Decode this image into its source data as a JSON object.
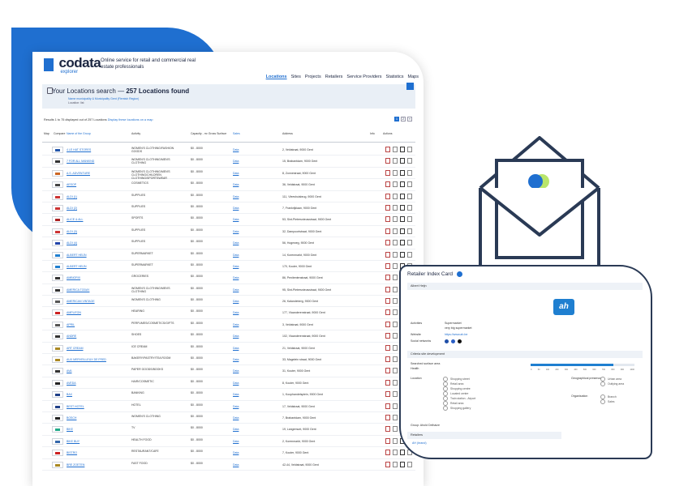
{
  "header": {
    "logo_main": "codata",
    "logo_sub": "explorer",
    "tagline": "Online service for retail and commercial real estate professionals"
  },
  "nav": [
    "Locations",
    "Sites",
    "Projects",
    "Retailers",
    "Service Providers",
    "Statistics",
    "Maps"
  ],
  "search": {
    "title_prefix": "Your Locations search",
    "title_count": "257 Locations found",
    "crumb_line1": "Name municipality & Municipality Gent (Flemish Region)",
    "crumb_line2": "Location: list"
  },
  "results": {
    "info": "Results 1 to 75 displayed out of 257 Locations",
    "map_link": "Display these locations on a map",
    "pages": [
      "1",
      "2",
      "»"
    ]
  },
  "table": {
    "headers": [
      "Map",
      "Compare",
      "Name of the Group",
      "Activity",
      "Capacity - m² Gross Surface",
      "Sales",
      "Address",
      "Info",
      "Actions"
    ],
    "rows": [
      {
        "name": "4 LE HAT STORES",
        "cat": "WOMEN'S CLOTHING/FASHION GOODS",
        "cap": "$0 - 8000",
        "sales": "Data",
        "addr": "2, Veldstraat, 9000 Gent",
        "color": "#2255aa"
      },
      {
        "name": "7 FOR ALL MANKIND",
        "cat": "WOMEN'S CLOTHING/MEN'S CLOTHING",
        "cap": "$0 - 8000",
        "sales": "Data",
        "addr": "15, Brabantdam, 9000 Gent",
        "color": "#333333"
      },
      {
        "name": "A.S. ADVENTURE",
        "cat": "WOMEN'S CLOTHING/MEN'S CLOTHING/CHILDREN CLOTHING/SPORTSWEAR",
        "cap": "$0 - 8000",
        "sales": "Data",
        "addr": "8, Zonnestraat, 9000 Gent",
        "color": "#cc6622"
      },
      {
        "name": "AESOP",
        "cat": "COSMETICS",
        "cap": "$0 - 8000",
        "sales": "Data",
        "addr": "36, Veldstraat, 9000 Gent",
        "color": "#444444"
      },
      {
        "name": "ALDI (1)",
        "cat": "SUPPLIES",
        "cap": "$0 - 8000",
        "sales": "Data",
        "addr": "111, Vleeshuisbrug, 9000 Gent",
        "color": "#cc3333"
      },
      {
        "name": "ALDI (2)",
        "cat": "SUPPLIES",
        "cap": "$0 - 8000",
        "sales": "Data",
        "addr": "7, Frankrijklaan, 9000 Gent",
        "color": "#cc3333"
      },
      {
        "name": "ALICE & ALL",
        "cat": "SPORTS",
        "cap": "$0 - 8000",
        "sales": "Data",
        "addr": "53, Sint-Pietersnieuwstraat, 9000 Gent",
        "color": "#aa2222"
      },
      {
        "name": "ALDI (3)",
        "cat": "SUPPLIES",
        "cap": "$0 - 8000",
        "sales": "Data",
        "addr": "32, Dampoortstraat, 9000 Gent",
        "color": "#cc3333"
      },
      {
        "name": "ALDI (4)",
        "cat": "SUPPLIES",
        "cap": "$0 - 8000",
        "sales": "Data",
        "addr": "56, Hogeweg, 9000 Gent",
        "color": "#2244aa"
      },
      {
        "name": "ALBERT HEIJN",
        "cat": "SUPERMARKET",
        "cap": "$0 - 8000",
        "sales": "Data",
        "addr": "14, Korenmarkt, 9000 Gent",
        "color": "#1f7fd0"
      },
      {
        "name": "ALBERT HEIJN",
        "cat": "SUPERMARKET",
        "cap": "$0 - 8000",
        "sales": "Data",
        "addr": "170, Kouter, 9000 Gent",
        "color": "#1f7fd0"
      },
      {
        "name": "AMBIORIX",
        "cat": "GROCERIES",
        "cap": "$0 - 8000",
        "sales": "Data",
        "addr": "86, Penitentenstraat, 9000 Gent",
        "color": "#333333"
      },
      {
        "name": "AMERICA TODAY",
        "cat": "WOMEN'S CLOTHING/MEN'S CLOTHING",
        "cap": "$0 - 8000",
        "sales": "Data",
        "addr": "95, Sint-Pietersnieuwstraat, 9000 Gent",
        "color": "#333333"
      },
      {
        "name": "AMERICAN VINTAGE",
        "cat": "WOMEN'S CLOTHING",
        "cap": "$0 - 8000",
        "sales": "Data",
        "addr": "26, Kalandeberg, 9000 Gent",
        "color": "#555555"
      },
      {
        "name": "AMPLIFON",
        "cat": "HEARING",
        "cap": "$0 - 8000",
        "sales": "Data",
        "addr": "177, Vlaanderenstraat, 9000 Gent",
        "color": "#cc2222"
      },
      {
        "name": "APRIL",
        "cat": "PERFUMES/COSMETICS/GIFTS",
        "cap": "$0 - 8000",
        "sales": "Data",
        "addr": "3, Veldstraat, 9000 Gent",
        "color": "#555555"
      },
      {
        "name": "ANDRE",
        "cat": "SHOES",
        "cap": "$0 - 8000",
        "sales": "Data",
        "addr": "102, Vlaanderenstraat, 9000 Gent",
        "color": "#333333"
      },
      {
        "name": "ART CREAM",
        "cat": "ICE CREAM",
        "cap": "$0 - 8000",
        "sales": "Data",
        "addr": "21, Veldstraat, 9000 Gent",
        "color": "#aa8822"
      },
      {
        "name": "AUX MERVEILLEUX DE FRED",
        "cat": "BAKERY/PASTRY/TEA ROOM",
        "cap": "$0 - 8000",
        "sales": "Data",
        "addr": "33, Magelein straat, 9000 Gent",
        "color": "#aa8822"
      },
      {
        "name": "AVA",
        "cat": "PAPER GOODS/BOOKS",
        "cap": "$0 - 8000",
        "sales": "Data",
        "addr": "31, Kouter, 9000 Gent",
        "color": "#333333"
      },
      {
        "name": "AVEDA",
        "cat": "HAIR/COSMETIC",
        "cap": "$0 - 8000",
        "sales": "Data",
        "addr": "8, Kouter, 9000 Gent",
        "color": "#222222"
      },
      {
        "name": "BAX",
        "cat": "BANKING",
        "cap": "$0 - 8000",
        "sales": "Data",
        "addr": "1, Koophandelsplein, 9000 Gent",
        "color": "#1f3f88"
      },
      {
        "name": "BEST HOTEL",
        "cat": "HOTEL",
        "cap": "$0 - 8000",
        "sales": "Data",
        "addr": "17, Veldstraat, 9000 Gent",
        "color": "#1f3f88"
      },
      {
        "name": "BOSCH",
        "cat": "WOMEN'S CLOTHING",
        "cap": "$0 - 8000",
        "sales": "Data",
        "addr": "7, Brabantdam, 9000 Gent",
        "color": "#222222"
      },
      {
        "name": "BIKE",
        "cat": "TV",
        "cap": "$0 - 8000",
        "sales": "Data",
        "addr": "19, Langemunt, 9000 Gent",
        "color": "#22aa88"
      },
      {
        "name": "BIKE BUY",
        "cat": "HEALTH FOOD",
        "cap": "$0 - 8000",
        "sales": "Data",
        "addr": "2, Korenmarkt, 9000 Gent",
        "color": "#3366aa"
      },
      {
        "name": "BISTRO",
        "cat": "RESTAURANT/CAFE",
        "cap": "$0 - 8000",
        "sales": "Data",
        "addr": "7, Kouter, 9000 Gent",
        "color": "#cc2222"
      },
      {
        "name": "BRE ZOETEN",
        "cat": "FAST FOOD",
        "cap": "$0 - 8000",
        "sales": "Data",
        "addr": "42-44, Veldstraat, 9000 Gent",
        "color": "#aa8822"
      }
    ]
  },
  "card": {
    "title": "Retailer Index Card",
    "group_label": "Albert Heijn",
    "logo_text": "ah",
    "fields": [
      {
        "k": "Activities",
        "v": "Supermarket"
      },
      {
        "k": "",
        "v": "very big supermarket"
      },
      {
        "k": "Website",
        "v": "https://www.ah.be"
      },
      {
        "k": "Social networks",
        "v": ""
      }
    ],
    "criteria_title": "Criteria site development",
    "criteria_label": "Searched surface area",
    "criteria_label2": "Health",
    "bar_fill": 0.8,
    "scale": [
      "0",
      "50",
      "100",
      "200",
      "300",
      "400",
      "500",
      "600",
      "700",
      "800",
      "900",
      "1000"
    ],
    "location_label": "Location",
    "location_opts": [
      "Shopping street",
      "Retail area",
      "Shopping centre",
      "Located centre",
      "Train station - Airport",
      "Retail area",
      "Shopping gallery"
    ],
    "geo_label": "Geographical presence",
    "geo_opts": [
      "Urban area",
      "Outlying area"
    ],
    "org_label": "Organisation",
    "org_opts": [
      "Branch",
      "Sales"
    ],
    "footer_group": "Group: Ahold Delhaize",
    "footer_label": "Retailers",
    "footer_link": "AH (brand)"
  }
}
